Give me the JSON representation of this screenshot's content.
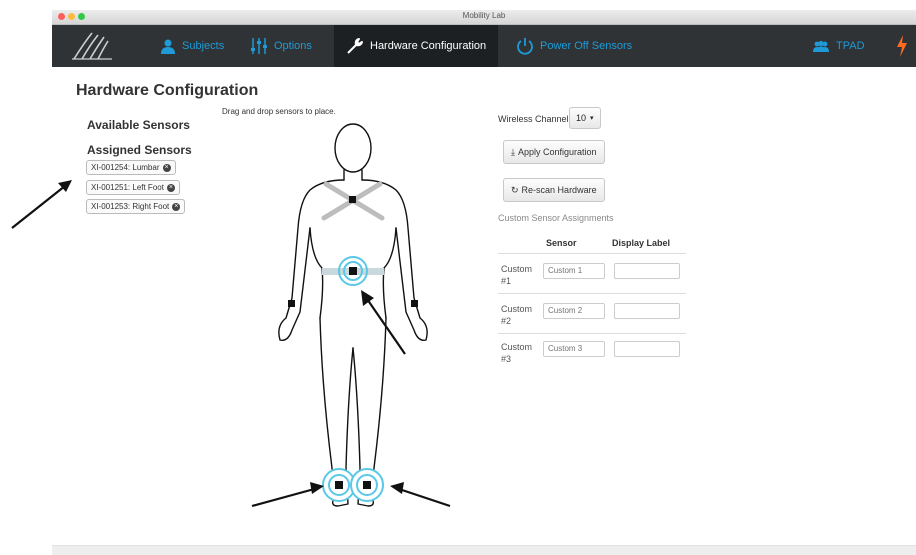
{
  "window": {
    "title": "Mobility Lab"
  },
  "nav": {
    "subjects": "Subjects",
    "options": "Options",
    "hardware_configuration": "Hardware Configuration",
    "power_off": "Power Off Sensors",
    "user": "TPAD"
  },
  "page": {
    "title": "Hardware Configuration",
    "hint": "Drag and drop sensors to place.",
    "available_heading": "Available Sensors",
    "assigned_heading": "Assigned Sensors",
    "assigned": [
      {
        "label": "XI-001254: Lumbar"
      },
      {
        "label": "XI-001251: Left Foot"
      },
      {
        "label": "XI-001253: Right Foot"
      }
    ]
  },
  "panel": {
    "wireless_label": "Wireless Channel:",
    "channel_value": "10",
    "apply_label": "Apply Configuration",
    "rescan_label": "Re-scan Hardware",
    "custom_heading": "Custom Sensor Assignments",
    "col_sensor": "Sensor",
    "col_display": "Display Label",
    "rows": [
      {
        "label": "Custom #1",
        "placeholder": "Custom 1"
      },
      {
        "label": "Custom #2",
        "placeholder": "Custom 2"
      },
      {
        "label": "Custom #3",
        "placeholder": "Custom 3"
      }
    ]
  },
  "colors": {
    "accent": "#1e9bd7",
    "nav_bg": "#2f3336",
    "power": "#ff6a1f",
    "sensor_ring": "#5ac8e6"
  }
}
